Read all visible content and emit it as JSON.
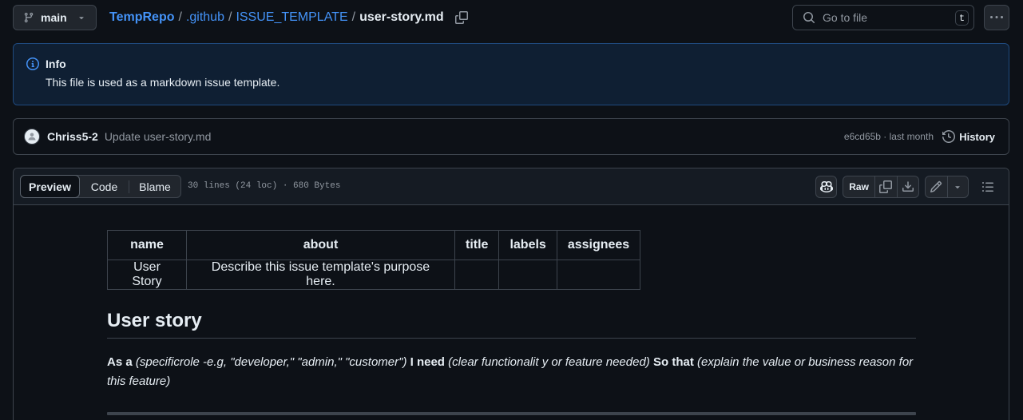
{
  "branch": {
    "name": "main"
  },
  "breadcrumb": {
    "repo": "TempRepo",
    "folder1": ".github",
    "folder2": "ISSUE_TEMPLATE",
    "file": "user-story.md",
    "separator": "/"
  },
  "search": {
    "placeholder": "Go to file",
    "shortcut": "t"
  },
  "flash": {
    "title": "Info",
    "body": "This file is used as a markdown issue template."
  },
  "commit": {
    "author": "Chriss5-2",
    "message": "Update user-story.md",
    "meta": "e6cd65b · last month",
    "history_label": "History"
  },
  "file_toolbar": {
    "tabs": [
      "Preview",
      "Code",
      "Blame"
    ],
    "active_tab": "Preview",
    "info": "30 lines (24 loc) · 680 Bytes",
    "raw_label": "Raw"
  },
  "frontmatter_table": {
    "headers": [
      "name",
      "about",
      "title",
      "labels",
      "assignees"
    ],
    "rows": [
      [
        "User Story",
        "Describe this issue template's purpose here.",
        "",
        "",
        ""
      ]
    ]
  },
  "markdown": {
    "heading": "User story",
    "as_a": "As a",
    "role": "(specificrole -e.g, \"developer,\" \"admin,\" \"customer\")",
    "i_need": "I need",
    "need": "(clear functionalit y or feature needed)",
    "so_that": "So that",
    "reason": "(explain the value or business reason for this feature)"
  },
  "colors": {
    "background": "#0d1117",
    "link": "#4493f8",
    "border": "#3d444d",
    "muted": "#9198a1",
    "flash_bg": "#0f1f33"
  },
  "icons": [
    "git-branch-icon",
    "copy-icon",
    "search-icon",
    "kebab-horizontal-icon",
    "info-icon",
    "avatar-icon",
    "history-icon",
    "copilot-icon",
    "copy-raw-icon",
    "download-icon",
    "pencil-icon",
    "triangle-down-icon",
    "list-unordered-icon"
  ]
}
